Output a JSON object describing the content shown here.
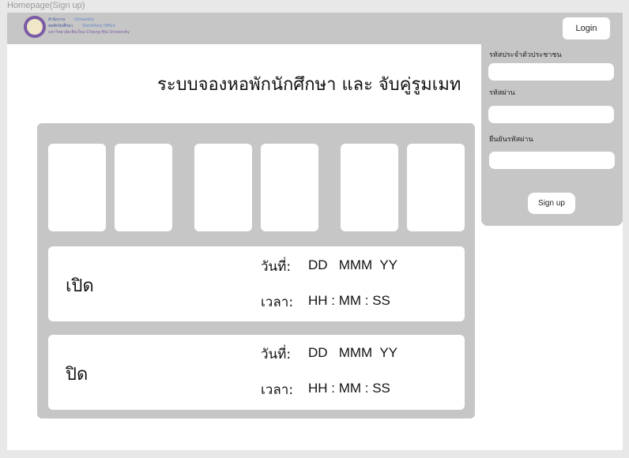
{
  "frame": {
    "label": "Homepage(Sign up)"
  },
  "header": {
    "logo": {
      "thai_line1": "สำนักงาน",
      "thai_line2": "หอพักนักศึกษา",
      "thai_line3": "มหาวิทยาลัยเชียงใหม่",
      "en_line1": "University",
      "en_line2": "Dormitory Office",
      "en_line3": "Chiang Mai University"
    },
    "login_label": "Login"
  },
  "main": {
    "title": "ระบบจองหอพักนักศึกษา และ จับคู่รูมเมท",
    "periods": [
      {
        "name": "เปิด",
        "date_label": "วันที่:",
        "date_value": "DD   MMM  YY",
        "time_label": "เวลา:",
        "time_value": "HH : MM : SS"
      },
      {
        "name": "ปิด",
        "date_label": "วันที่:",
        "date_value": "DD   MMM  YY",
        "time_label": "เวลา:",
        "time_value": "HH : MM : SS"
      }
    ]
  },
  "signup": {
    "id_label": "รหัสประจำตัวประชาชน",
    "password_label": "รหัสผ่าน",
    "confirm_label": "ยืนยันรหัสผ่าน",
    "button_label": "Sign up"
  }
}
